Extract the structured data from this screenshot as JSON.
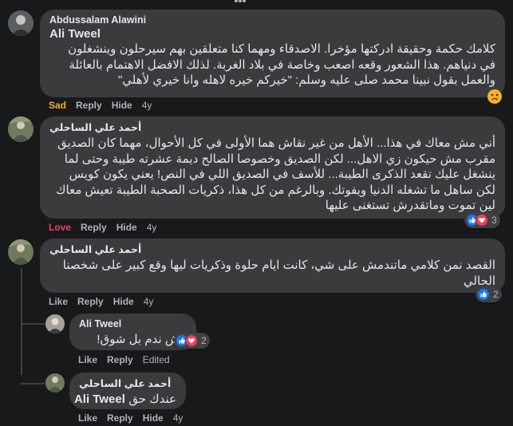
{
  "comments": [
    {
      "author": "Abdussalam Alawini",
      "mention": "Ali Tweel",
      "text": "كلامك حكمة وحقيقة ادركتها مؤخرا. الاصدقاء ومهما كنا متعلقين بهم سيرحلون وينشغلون في دنياهم. هذا الشعور وقعه اصعب وخاصة في بلاد الغربة. لذلك الافضل الاهتمام بالعائلة والعمل بقول نبينا محمد صلى عليه وسلم: \"خيركم خيره لاهله وانا خيري لأهلي\"",
      "reaction_label": "Sad",
      "reply": "Reply",
      "hide": "Hide",
      "age": "4y"
    },
    {
      "author": "أحمد علي الساحلي",
      "text": "أني مش معاك في هذا... الأهل من غير نقاش هما الأولى في كل الأحوال، مهما كان الصديق مقرب مش حيكون زي الاهل... لكن الصديق وخصوصا الصالح ديمة عشرته طيبة وحتى لما ينشغل عليك تقعد الذكرى الطيبة... للأسف في الصديق اللي في النص! يعني يكون كويس لكن ساهل ما تشغله الدنيا ويفوتك. وبالرغم من كل هذا، ذكريات الصحبة الطيبة تعيش معاك لين تموت وماتقدرش تستغنى عليها",
      "reaction_label": "Love",
      "reply": "Reply",
      "hide": "Hide",
      "age": "4y",
      "reaction_count": "3"
    },
    {
      "author": "أحمد علي الساحلي",
      "text": "القصد نمن كلامي ماتندمش على شي، كانت ايام حلوة وذكريات ليها وقع كبير على شخصنا الحالي",
      "like": "Like",
      "reply": "Reply",
      "hide": "Hide",
      "age": "4y",
      "reaction_count": "2"
    },
    {
      "author": "Ali Tweel",
      "text": "مش ندم بل شوق!",
      "like": "Like",
      "reply": "Reply",
      "edited": "Edited",
      "reaction_count": "2"
    },
    {
      "author": "أحمد علي الساحلي",
      "mention": "Ali Tweel",
      "text": "عندك حق",
      "like": "Like",
      "reply": "Reply",
      "hide": "Hide",
      "age": "4y"
    }
  ],
  "colors": {
    "background": "#18191a",
    "bubble": "#3a3b3c",
    "like_blue": "#1877f2",
    "love_red": "#f33e58",
    "sad_yellow": "#f7b125"
  }
}
